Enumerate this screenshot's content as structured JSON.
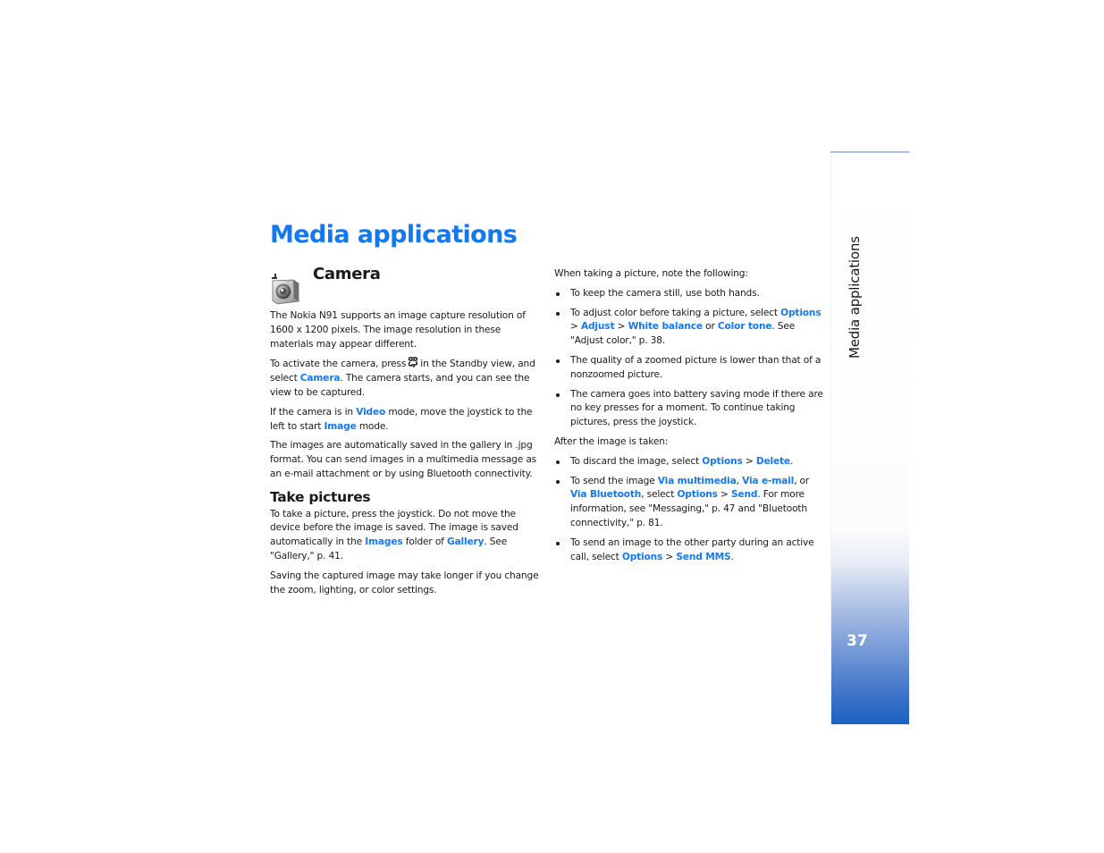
{
  "page": {
    "title": "Media applications",
    "page_number": "37",
    "side_tab_label": "Media applications"
  },
  "left": {
    "section_title": "Camera",
    "section_icon": "camera-icon",
    "p1": "The Nokia N91 supports an image capture resolution of 1600 x 1200 pixels. The image resolution in these materials may appear different.",
    "p2": {
      "a": "To activate the camera, press",
      "key_icon": "menu-key-icon",
      "b": "in the Standby view, and select",
      "link": "Camera",
      "c": ". The camera starts, and you can see the view to be captured."
    },
    "p3": {
      "a": "If the camera is in",
      "link1": "Video",
      "b": "mode, move the joystick to the left to start",
      "link2": "Image",
      "c": "mode."
    },
    "p4": "The images are automatically saved in the gallery in .jpg format. You can send images in a multimedia message as an e-mail attachment or by using Bluetooth connectivity.",
    "subsection_title": "Take pictures",
    "p5": {
      "a": "To take a picture, press the joystick. Do not move the device before the image is saved. The image is saved automatically in the",
      "link1": "Images",
      "b": "folder of",
      "link2": "Gallery",
      "c": ". See \"Gallery,\" p. 41."
    },
    "p6": "Saving the captured image may take longer if you change the zoom, lighting, or color settings."
  },
  "right": {
    "intro1": "When taking a picture, note the following:",
    "bullets1": [
      {
        "text": "To keep the camera still, use both hands."
      },
      {
        "a": "To adjust color before taking a picture, select",
        "l1": "Options",
        "s1": " > ",
        "l2": "Adjust",
        "s2": " > ",
        "l3": "White balance",
        "s3": " or ",
        "l4": "Color tone",
        "c": ". See \"Adjust color,\" p. 38."
      },
      {
        "text": "The quality of a zoomed picture is lower than that of a nonzoomed picture."
      },
      {
        "text": "The camera goes into battery saving mode if there are no key presses for a moment. To continue taking pictures, press the joystick."
      }
    ],
    "intro2": "After the image is taken:",
    "bullets2": [
      {
        "a": "To discard the image, select",
        "l1": "Options",
        "s1": " > ",
        "l2": "Delete",
        "c": "."
      },
      {
        "a": "To send the image",
        "l1": "Via multimedia",
        "s1": ", ",
        "l2": "Via e-mail",
        "s2": ", or ",
        "l3": "Via Bluetooth",
        "s3": ", select ",
        "l4": "Options",
        "s4": " > ",
        "l5": "Send",
        "c": ". For more information, see \"Messaging,\" p. 47 and \"Bluetooth connectivity,\" p. 81."
      },
      {
        "a": "To send an image to the other party during an active call, select",
        "l1": "Options",
        "s1": " > ",
        "l2": "Send MMS",
        "c": "."
      }
    ]
  },
  "colors": {
    "accent_blue": "#1478f0",
    "tab_gradient_bottom": "#1a62c0",
    "text": "#1a1a1a"
  }
}
